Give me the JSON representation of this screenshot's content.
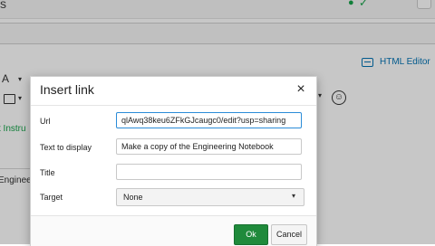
{
  "background": {
    "top_fragment": "s",
    "html_editor_label": "HTML Editor",
    "instructions_fragment": "t Instru",
    "engineering_fragment": "Enginee"
  },
  "dialog": {
    "title": "Insert link",
    "close_label": "×",
    "fields": {
      "url_label": "Url",
      "url_value": "qlAwq38keu6ZFkGJcaugc0/edit?usp=sharing",
      "text_label": "Text to display",
      "text_value": "Make a copy of the Engineering Notebook",
      "title_label": "Title",
      "title_value": "",
      "target_label": "Target",
      "target_value": "None"
    },
    "ok_label": "Ok",
    "cancel_label": "Cancel"
  },
  "colors": {
    "ok_button": "#1f8a3b",
    "focus_border": "#2b8cd8",
    "link_blue": "#0374b5",
    "published_green": "#16a34a"
  }
}
